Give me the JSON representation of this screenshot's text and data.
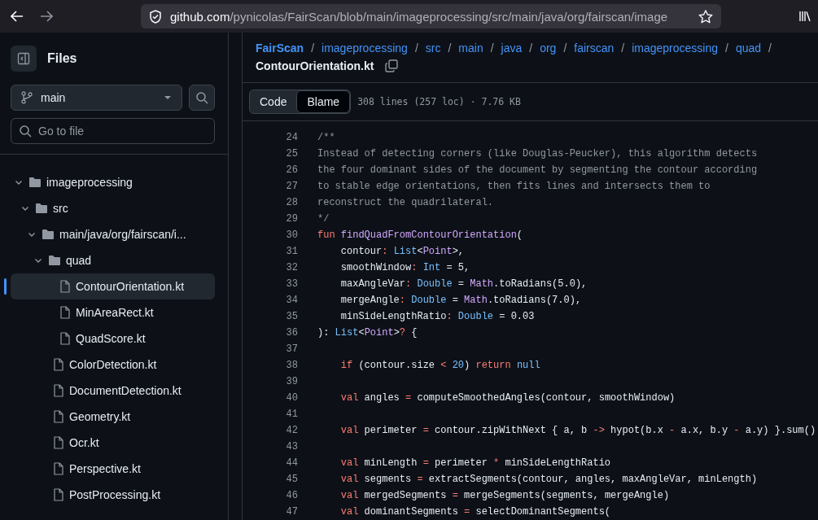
{
  "browser": {
    "url_host": "github.com",
    "url_path": "/pynicolas/FairScan/blob/main/imageprocessing/src/main/java/org/fairscan/image"
  },
  "sidebar": {
    "title": "Files",
    "branch": "main",
    "search": {
      "placeholder": "Go to file"
    },
    "tree": [
      {
        "label": "imageprocessing",
        "kind": "folder",
        "expanded": true,
        "selected": false,
        "children": [
          {
            "label": "src",
            "kind": "folder",
            "expanded": true,
            "selected": false,
            "children": [
              {
                "label": "main/java/org/fairscan/i...",
                "kind": "folder",
                "expanded": true,
                "selected": false,
                "children": [
                  {
                    "label": "quad",
                    "kind": "folder",
                    "expanded": true,
                    "selected": false,
                    "children": [
                      {
                        "label": "ContourOrientation.kt",
                        "kind": "file",
                        "selected": true
                      },
                      {
                        "label": "MinAreaRect.kt",
                        "kind": "file",
                        "selected": false
                      },
                      {
                        "label": "QuadScore.kt",
                        "kind": "file",
                        "selected": false
                      }
                    ]
                  },
                  {
                    "label": "ColorDetection.kt",
                    "kind": "file",
                    "selected": false
                  },
                  {
                    "label": "DocumentDetection.kt",
                    "kind": "file",
                    "selected": false
                  },
                  {
                    "label": "Geometry.kt",
                    "kind": "file",
                    "selected": false
                  },
                  {
                    "label": "Ocr.kt",
                    "kind": "file",
                    "selected": false
                  },
                  {
                    "label": "Perspective.kt",
                    "kind": "file",
                    "selected": false
                  },
                  {
                    "label": "PostProcessing.kt",
                    "kind": "file",
                    "selected": false
                  }
                ]
              }
            ]
          }
        ]
      }
    ]
  },
  "breadcrumb": {
    "links": [
      "FairScan",
      "imageprocessing",
      "src",
      "main",
      "java",
      "org",
      "fairscan",
      "imageprocessing",
      "quad"
    ],
    "separator": "/",
    "current": "ContourOrientation.kt"
  },
  "view_tabs": [
    {
      "label": "Code",
      "selected": false
    },
    {
      "label": "Blame",
      "selected": true
    }
  ],
  "file_info": "308 lines (257 loc) · 7.76 KB",
  "code": [
    {
      "n": "24",
      "tokens": [
        {
          "t": "/**",
          "kind": "comment"
        }
      ]
    },
    {
      "n": "25",
      "tokens": [
        {
          "t": "Instead of detecting corners (like Douglas-Peucker), this algorithm detects",
          "kind": "comment"
        }
      ]
    },
    {
      "n": "26",
      "tokens": [
        {
          "t": "the four dominant sides of the document by segmenting the contour according",
          "kind": "comment"
        }
      ]
    },
    {
      "n": "27",
      "tokens": [
        {
          "t": "to stable edge orientations, then fits lines and intersects them to",
          "kind": "comment"
        }
      ]
    },
    {
      "n": "28",
      "tokens": [
        {
          "t": "reconstruct the quadrilateral.",
          "kind": "comment"
        }
      ]
    },
    {
      "n": "29",
      "tokens": [
        {
          "t": "*/",
          "kind": "comment"
        }
      ]
    },
    {
      "n": "30",
      "tokens": [
        {
          "t": "fun ",
          "kind": "keyword"
        },
        {
          "t": "findQuadFromContourOrientation",
          "kind": "function"
        },
        {
          "t": "(",
          "kind": "plain"
        }
      ]
    },
    {
      "n": "31",
      "tokens": [
        {
          "t": "    contour",
          "kind": "plain"
        },
        {
          "t": ": ",
          "kind": "keyword"
        },
        {
          "t": "List",
          "kind": "type"
        },
        {
          "t": "<",
          "kind": "plain"
        },
        {
          "t": "Point",
          "kind": "function"
        },
        {
          "t": ">,",
          "kind": "plain"
        }
      ]
    },
    {
      "n": "32",
      "tokens": [
        {
          "t": "    smoothWindow",
          "kind": "plain"
        },
        {
          "t": ": ",
          "kind": "keyword"
        },
        {
          "t": "Int",
          "kind": "type"
        },
        {
          "t": " = 5,",
          "kind": "plain"
        }
      ]
    },
    {
      "n": "33",
      "tokens": [
        {
          "t": "    maxAngleVar",
          "kind": "plain"
        },
        {
          "t": ": ",
          "kind": "keyword"
        },
        {
          "t": "Double",
          "kind": "type"
        },
        {
          "t": " = ",
          "kind": "plain"
        },
        {
          "t": "Math",
          "kind": "function"
        },
        {
          "t": ".toRadians(5.0),",
          "kind": "plain"
        }
      ]
    },
    {
      "n": "34",
      "tokens": [
        {
          "t": "    mergeAngle",
          "kind": "plain"
        },
        {
          "t": ": ",
          "kind": "keyword"
        },
        {
          "t": "Double",
          "kind": "type"
        },
        {
          "t": " = ",
          "kind": "plain"
        },
        {
          "t": "Math",
          "kind": "function"
        },
        {
          "t": ".toRadians(7.0),",
          "kind": "plain"
        }
      ]
    },
    {
      "n": "35",
      "tokens": [
        {
          "t": "    minSideLengthRatio",
          "kind": "plain"
        },
        {
          "t": ": ",
          "kind": "keyword"
        },
        {
          "t": "Double",
          "kind": "type"
        },
        {
          "t": " = 0.03",
          "kind": "plain"
        }
      ]
    },
    {
      "n": "36",
      "tokens": [
        {
          "t": "): ",
          "kind": "plain"
        },
        {
          "t": "List",
          "kind": "type"
        },
        {
          "t": "<",
          "kind": "plain"
        },
        {
          "t": "Point",
          "kind": "function"
        },
        {
          "t": ">",
          "kind": "plain"
        },
        {
          "t": "?",
          "kind": "keyword"
        },
        {
          "t": " {",
          "kind": "plain"
        }
      ]
    },
    {
      "n": "37"
    },
    {
      "n": "38",
      "tokens": [
        {
          "t": "    if ",
          "kind": "keyword"
        },
        {
          "t": "(contour.size ",
          "kind": "plain"
        },
        {
          "t": "< ",
          "kind": "keyword"
        },
        {
          "t": "20",
          "kind": "type"
        },
        {
          "t": ") ",
          "kind": "plain"
        },
        {
          "t": "return ",
          "kind": "keyword"
        },
        {
          "t": "null",
          "kind": "type"
        }
      ]
    },
    {
      "n": "39"
    },
    {
      "n": "40",
      "tokens": [
        {
          "t": "    val ",
          "kind": "keyword"
        },
        {
          "t": "angles ",
          "kind": "plain"
        },
        {
          "t": "= ",
          "kind": "keyword"
        },
        {
          "t": "computeSmoothedAngles(contour, smoothWindow)",
          "kind": "plain"
        }
      ]
    },
    {
      "n": "41"
    },
    {
      "n": "42",
      "tokens": [
        {
          "t": "    val ",
          "kind": "keyword"
        },
        {
          "t": "perimeter ",
          "kind": "plain"
        },
        {
          "t": "= ",
          "kind": "keyword"
        },
        {
          "t": "contour.zipWithNext { a, b ",
          "kind": "plain"
        },
        {
          "t": "-> ",
          "kind": "keyword"
        },
        {
          "t": "hypot(b.x ",
          "kind": "plain"
        },
        {
          "t": "- ",
          "kind": "keyword"
        },
        {
          "t": "a.x, b.y ",
          "kind": "plain"
        },
        {
          "t": "- ",
          "kind": "keyword"
        },
        {
          "t": "a.y) }.sum()",
          "kind": "plain"
        }
      ]
    },
    {
      "n": "43"
    },
    {
      "n": "44",
      "tokens": [
        {
          "t": "    val ",
          "kind": "keyword"
        },
        {
          "t": "minLength ",
          "kind": "plain"
        },
        {
          "t": "= ",
          "kind": "keyword"
        },
        {
          "t": "perimeter ",
          "kind": "plain"
        },
        {
          "t": "* ",
          "kind": "keyword"
        },
        {
          "t": "minSideLengthRatio",
          "kind": "plain"
        }
      ]
    },
    {
      "n": "45",
      "tokens": [
        {
          "t": "    val ",
          "kind": "keyword"
        },
        {
          "t": "segments ",
          "kind": "plain"
        },
        {
          "t": "= ",
          "kind": "keyword"
        },
        {
          "t": "extractSegments(contour, angles, maxAngleVar, minLength)",
          "kind": "plain"
        }
      ]
    },
    {
      "n": "46",
      "tokens": [
        {
          "t": "    val ",
          "kind": "keyword"
        },
        {
          "t": "mergedSegments ",
          "kind": "plain"
        },
        {
          "t": "= ",
          "kind": "keyword"
        },
        {
          "t": "mergeSegments(segments, mergeAngle)",
          "kind": "plain"
        }
      ]
    },
    {
      "n": "47",
      "tokens": [
        {
          "t": "    val ",
          "kind": "keyword"
        },
        {
          "t": "dominantSegments ",
          "kind": "plain"
        },
        {
          "t": "= ",
          "kind": "keyword"
        },
        {
          "t": "selectDominantSegments(",
          "kind": "plain"
        }
      ]
    }
  ]
}
